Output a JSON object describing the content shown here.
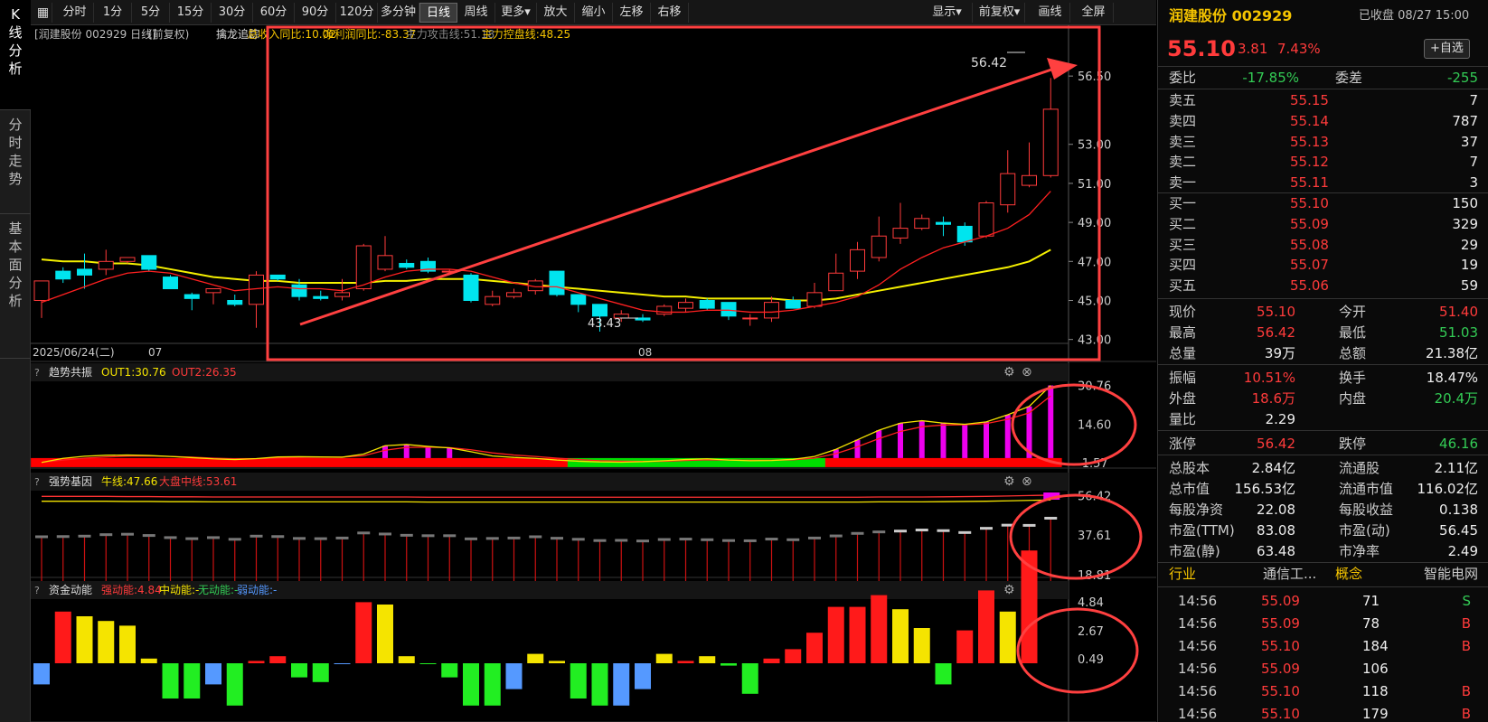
{
  "side_tabs": [
    "K线分析",
    "分时走势",
    "基本面分析"
  ],
  "toolbar": {
    "items": [
      "分时",
      "1分",
      "5分",
      "15分",
      "30分",
      "60分",
      "90分",
      "120分",
      "多分钟",
      "日线",
      "周线",
      "更多▾",
      "放大",
      "缩小",
      "左移",
      "右移"
    ],
    "active": "日线",
    "right": [
      "显示▾",
      "前复权▾",
      "画线",
      "全屏"
    ]
  },
  "chart": {
    "title": "[润建股份 002929 日线]",
    "fq": "(前复权)",
    "ind": [
      {
        "t": "擒龙追踪",
        "c": "#ddd"
      },
      {
        "t": "总收入同比:10.02",
        "c": "#f5c400"
      },
      {
        "t": "净利润同比:-83.37",
        "c": "#f5c400"
      },
      {
        "t": "主力攻击线:51.18",
        "c": "#888"
      },
      {
        "t": "主力控盘线:48.25",
        "c": "#f5c400"
      }
    ],
    "yticks": [
      "56.50",
      "53.00",
      "51.00",
      "49.00",
      "47.00",
      "45.00",
      "43.00"
    ],
    "xlabels": [
      "2025/06/24(二)",
      "07",
      "08"
    ],
    "high_label": "56.42",
    "low_label": "43.43"
  },
  "panels": [
    {
      "name": "趋势共振",
      "legend": [
        {
          "t": "OUT1:30.76",
          "c": "#f5e400"
        },
        {
          "t": "OUT2:26.35",
          "c": "#ff3b3b"
        }
      ],
      "ticks": [
        "30.76",
        "14.60",
        "-1.57"
      ]
    },
    {
      "name": "强势基因",
      "legend": [
        {
          "t": "牛线:47.66",
          "c": "#f5e400"
        },
        {
          "t": "大盘中线:53.61",
          "c": "#ff3b3b"
        }
      ],
      "ticks": [
        "56.42",
        "37.61",
        "18.81"
      ]
    },
    {
      "name": "资金动能",
      "legend": [
        {
          "t": "强动能:4.84",
          "c": "#ff3b3b"
        },
        {
          "t": "中动能:-",
          "c": "#f5e400"
        },
        {
          "t": "无动能:-",
          "c": "#33cc55"
        },
        {
          "t": "弱动能:-",
          "c": "#5599ff"
        }
      ],
      "ticks": [
        "4.84",
        "2.67",
        "0.49"
      ]
    }
  ],
  "candles": [
    [
      45.0,
      46.0,
      44.1,
      46.0
    ],
    [
      46.5,
      46.1,
      45.9,
      46.7
    ],
    [
      46.6,
      46.3,
      45.6,
      47.4
    ],
    [
      46.6,
      47.0,
      46.3,
      47.6
    ],
    [
      47.0,
      47.2,
      46.9,
      47.2
    ],
    [
      47.3,
      46.6,
      46.5,
      47.3
    ],
    [
      46.2,
      45.6,
      45.6,
      46.3
    ],
    [
      45.3,
      45.1,
      44.5,
      45.4
    ],
    [
      45.4,
      45.6,
      44.8,
      45.6
    ],
    [
      45.0,
      44.8,
      44.7,
      45.3
    ],
    [
      44.8,
      46.3,
      43.6,
      46.5
    ],
    [
      46.3,
      46.1,
      46.0,
      46.3
    ],
    [
      45.8,
      45.2,
      45.0,
      46.1
    ],
    [
      45.2,
      45.1,
      45.0,
      45.5
    ],
    [
      45.2,
      45.4,
      45.0,
      46.1
    ],
    [
      45.6,
      47.8,
      45.5,
      47.9
    ],
    [
      46.6,
      47.3,
      46.5,
      48.3
    ],
    [
      46.9,
      46.7,
      46.6,
      47.1
    ],
    [
      47.0,
      46.5,
      46.4,
      47.2
    ],
    [
      46.5,
      46.5,
      46.3,
      46.6
    ],
    [
      46.3,
      45.0,
      44.9,
      46.4
    ],
    [
      44.8,
      45.2,
      44.7,
      45.5
    ],
    [
      45.2,
      45.4,
      45.1,
      45.6
    ],
    [
      45.5,
      46.0,
      45.3,
      46.1
    ],
    [
      46.5,
      45.3,
      45.2,
      46.5
    ],
    [
      45.3,
      44.8,
      44.4,
      45.3
    ],
    [
      44.8,
      44.2,
      43.4,
      44.8
    ],
    [
      44.1,
      44.3,
      43.9,
      44.5
    ],
    [
      44.1,
      44.0,
      43.9,
      44.3
    ],
    [
      44.3,
      44.7,
      44.2,
      44.8
    ],
    [
      44.6,
      44.9,
      44.4,
      45.1
    ],
    [
      45.0,
      44.6,
      44.5,
      45.1
    ],
    [
      44.9,
      44.2,
      44.0,
      44.9
    ],
    [
      44.1,
      44.1,
      43.7,
      44.3
    ],
    [
      44.1,
      44.9,
      43.9,
      45.2
    ],
    [
      45.0,
      44.6,
      44.6,
      45.2
    ],
    [
      44.7,
      45.4,
      44.6,
      45.9
    ],
    [
      45.5,
      46.4,
      45.5,
      47.4
    ],
    [
      46.5,
      47.6,
      46.1,
      48.0
    ],
    [
      47.2,
      48.3,
      47.0,
      49.3
    ],
    [
      48.2,
      48.7,
      47.9,
      50.0
    ],
    [
      48.7,
      49.2,
      48.6,
      49.4
    ],
    [
      49.0,
      48.9,
      48.3,
      49.3
    ],
    [
      48.8,
      48.0,
      47.8,
      49.0
    ],
    [
      48.3,
      50.0,
      48.2,
      50.1
    ],
    [
      49.9,
      51.5,
      49.5,
      52.7
    ],
    [
      50.9,
      51.4,
      50.8,
      53.1
    ],
    [
      51.4,
      54.8,
      51.3,
      56.4
    ]
  ],
  "ma_fast": [
    44.9,
    45.3,
    45.7,
    46.1,
    46.4,
    46.5,
    46.4,
    46.1,
    45.8,
    45.5,
    45.6,
    45.7,
    45.6,
    45.6,
    45.5,
    45.8,
    46.2,
    46.5,
    46.6,
    46.6,
    46.5,
    46.2,
    45.9,
    45.7,
    45.7,
    45.4,
    45.1,
    44.8,
    44.5,
    44.4,
    44.4,
    44.5,
    44.5,
    44.4,
    44.4,
    44.5,
    44.7,
    44.9,
    45.2,
    45.8,
    46.6,
    47.2,
    47.7,
    48.0,
    48.3,
    48.7,
    49.4,
    50.6
  ],
  "ma_slow": [
    47.1,
    47.0,
    47.0,
    46.9,
    46.9,
    46.8,
    46.6,
    46.4,
    46.2,
    46.1,
    46.0,
    46.0,
    45.9,
    45.9,
    45.9,
    45.9,
    46.0,
    46.0,
    46.1,
    46.1,
    46.1,
    46.0,
    45.9,
    45.8,
    45.7,
    45.6,
    45.5,
    45.4,
    45.3,
    45.2,
    45.2,
    45.1,
    45.1,
    45.1,
    45.1,
    45.0,
    45.0,
    45.1,
    45.3,
    45.5,
    45.7,
    45.9,
    46.1,
    46.3,
    46.5,
    46.7,
    47.0,
    47.6
  ],
  "trend_out1": [
    -1.5,
    0.2,
    1.1,
    1.5,
    1.6,
    1.4,
    1.0,
    0.5,
    0.0,
    -0.3,
    0.1,
    0.8,
    0.9,
    0.8,
    0.7,
    2.0,
    5.5,
    6.0,
    5.2,
    4.6,
    3.0,
    1.2,
    0.6,
    0.2,
    -0.5,
    -1.0,
    -1.3,
    -1.4,
    -1.2,
    -0.8,
    -0.3,
    0.0,
    -0.5,
    -0.8,
    -0.7,
    -0.2,
    1.0,
    4.0,
    8.0,
    12.0,
    15.0,
    16.0,
    15.0,
    14.5,
    15.5,
    18.5,
    22.0,
    30.8
  ],
  "trend_out2": [
    -1.5,
    -0.5,
    0.3,
    0.8,
    1.1,
    1.2,
    1.0,
    0.7,
    0.3,
    0.0,
    0.0,
    0.4,
    0.6,
    0.7,
    0.7,
    1.3,
    3.6,
    4.8,
    4.9,
    4.7,
    3.8,
    2.5,
    1.6,
    1.0,
    0.3,
    -0.3,
    -0.8,
    -1.0,
    -1.1,
    -1.0,
    -0.7,
    -0.4,
    -0.5,
    -0.6,
    -0.6,
    -0.4,
    0.3,
    2.2,
    5.1,
    8.5,
    11.5,
    13.5,
    14.2,
    14.3,
    14.8,
    16.6,
    19.3,
    26.4
  ],
  "trend_bars": [
    0,
    0,
    0,
    0,
    0,
    0,
    0,
    0,
    0,
    0,
    0,
    0,
    0,
    0,
    0,
    0,
    5.5,
    6.0,
    5.2,
    4.6,
    0,
    0,
    0,
    0,
    0,
    0,
    0,
    0,
    0,
    0,
    0,
    0,
    0,
    0,
    0,
    0,
    0,
    4.0,
    8.0,
    12.0,
    15.0,
    16.0,
    15.0,
    14.5,
    15.5,
    18.5,
    22.0,
    30.8
  ],
  "trend_band": [
    1,
    1,
    1,
    1,
    1,
    1,
    1,
    1,
    1,
    1,
    1,
    1,
    1,
    1,
    1,
    1,
    1,
    1,
    1,
    1,
    1,
    1,
    1,
    1,
    1,
    0,
    0,
    0,
    0,
    0,
    0,
    0,
    0,
    0,
    0,
    0,
    0,
    1,
    1,
    1,
    1,
    1,
    1,
    1,
    1,
    1,
    1,
    1
  ],
  "gene_line": [
    56.0,
    56.0,
    56.0,
    56.0,
    55.9,
    55.9,
    55.8,
    55.8,
    55.7,
    55.7,
    55.7,
    55.7,
    55.7,
    55.7,
    55.7,
    55.7,
    55.7,
    55.7,
    55.6,
    55.6,
    55.6,
    55.6,
    55.6,
    55.6,
    55.6,
    55.6,
    55.6,
    55.6,
    55.6,
    55.6,
    55.6,
    55.6,
    55.6,
    55.6,
    55.6,
    55.6,
    55.6,
    55.6,
    55.6,
    55.7,
    55.7,
    55.7,
    55.8,
    55.9,
    56.0,
    56.2,
    56.4,
    56.6
  ],
  "money": [
    {
      "v": 0.9,
      "c": "#5599ff"
    },
    {
      "v": 2.2,
      "c": "#ff1a1a"
    },
    {
      "v": 2.0,
      "c": "#f5e400"
    },
    {
      "v": 1.8,
      "c": "#f5e400"
    },
    {
      "v": 1.6,
      "c": "#f5e400"
    },
    {
      "v": 0.2,
      "c": "#f5e400"
    },
    {
      "v": 1.5,
      "c": "#22ee22"
    },
    {
      "v": 1.5,
      "c": "#22ee22"
    },
    {
      "v": 0.9,
      "c": "#5599ff"
    },
    {
      "v": 1.8,
      "c": "#22ee22"
    },
    {
      "v": 0.1,
      "c": "#ff1a1a"
    },
    {
      "v": 0.3,
      "c": "#ff1a1a"
    },
    {
      "v": 0.6,
      "c": "#22ee22"
    },
    {
      "v": 0.8,
      "c": "#22ee22"
    },
    {
      "v": 0.0,
      "c": "#5599ff"
    },
    {
      "v": 2.6,
      "c": "#ff1a1a"
    },
    {
      "v": 2.5,
      "c": "#f5e400"
    },
    {
      "v": 0.3,
      "c": "#f5e400"
    },
    {
      "v": 0.0,
      "c": "#22ee22"
    },
    {
      "v": 0.6,
      "c": "#22ee22"
    },
    {
      "v": 1.8,
      "c": "#22ee22"
    },
    {
      "v": 1.8,
      "c": "#22ee22"
    },
    {
      "v": 1.1,
      "c": "#5599ff"
    },
    {
      "v": 0.4,
      "c": "#f5e400"
    },
    {
      "v": 0.1,
      "c": "#f5e400"
    },
    {
      "v": 1.5,
      "c": "#22ee22"
    },
    {
      "v": 1.8,
      "c": "#22ee22"
    },
    {
      "v": 1.8,
      "c": "#5599ff"
    },
    {
      "v": 1.1,
      "c": "#5599ff"
    },
    {
      "v": 0.4,
      "c": "#f5e400"
    },
    {
      "v": 0.1,
      "c": "#ff1a1a"
    },
    {
      "v": 0.3,
      "c": "#f5e400"
    },
    {
      "v": 0.1,
      "c": "#22ee22"
    },
    {
      "v": 1.3,
      "c": "#22ee22"
    },
    {
      "v": 0.2,
      "c": "#ff1a1a"
    },
    {
      "v": 0.6,
      "c": "#ff1a1a"
    },
    {
      "v": 1.3,
      "c": "#ff1a1a"
    },
    {
      "v": 2.4,
      "c": "#ff1a1a"
    },
    {
      "v": 2.4,
      "c": "#ff1a1a"
    },
    {
      "v": 2.9,
      "c": "#ff1a1a"
    },
    {
      "v": 2.3,
      "c": "#f5e400"
    },
    {
      "v": 1.5,
      "c": "#f5e400"
    },
    {
      "v": 0.9,
      "c": "#22ee22"
    },
    {
      "v": 1.4,
      "c": "#ff1a1a"
    },
    {
      "v": 3.1,
      "c": "#ff1a1a"
    },
    {
      "v": 2.2,
      "c": "#f5e400"
    },
    {
      "v": 4.8,
      "c": "#ff1a1a"
    }
  ],
  "quote": {
    "name": "润建股份 002929",
    "status": "已收盘 08/27 15:00",
    "price": "55.10",
    "chg": "3.81",
    "pct": "7.43%",
    "fav": "+自选",
    "wb_label": "委比",
    "wb": "-17.85%",
    "wc_label": "委差",
    "wc": "-255",
    "asks": [
      [
        "卖五",
        "55.15",
        "7"
      ],
      [
        "卖四",
        "55.14",
        "787"
      ],
      [
        "卖三",
        "55.13",
        "37"
      ],
      [
        "卖二",
        "55.12",
        "7"
      ],
      [
        "卖一",
        "55.11",
        "3"
      ]
    ],
    "bids": [
      [
        "买一",
        "55.10",
        "150"
      ],
      [
        "买二",
        "55.09",
        "329"
      ],
      [
        "买三",
        "55.08",
        "29"
      ],
      [
        "买四",
        "55.07",
        "19"
      ],
      [
        "买五",
        "55.06",
        "59"
      ]
    ],
    "stats": [
      [
        [
          "现价",
          "55.10",
          "red"
        ],
        [
          "今开",
          "51.40",
          "red"
        ]
      ],
      [
        [
          "最高",
          "56.42",
          "red"
        ],
        [
          "最低",
          "51.03",
          "grn"
        ]
      ],
      [
        [
          "总量",
          "39万",
          "wht"
        ],
        [
          "总额",
          "21.38亿",
          "wht"
        ]
      ],
      [
        [
          "振幅",
          "10.51%",
          "red"
        ],
        [
          "换手",
          "18.47%",
          "wht"
        ]
      ],
      [
        [
          "外盘",
          "18.6万",
          "red"
        ],
        [
          "内盘",
          "20.4万",
          "grn"
        ]
      ],
      [
        [
          "量比",
          "2.29",
          "wht"
        ]
      ],
      [
        [
          "涨停",
          "56.42",
          "red"
        ],
        [
          "跌停",
          "46.16",
          "grn"
        ]
      ],
      [
        [
          "总股本",
          "2.84亿",
          "wht"
        ],
        [
          "流通股",
          "2.11亿",
          "wht"
        ]
      ],
      [
        [
          "总市值",
          "156.53亿",
          "wht"
        ],
        [
          "流通市值",
          "116.02亿",
          "wht"
        ]
      ],
      [
        [
          "每股净资",
          "22.08",
          "wht"
        ],
        [
          "每股收益",
          "0.138",
          "wht"
        ]
      ],
      [
        [
          "市盈(TTM)",
          "83.08",
          "wht"
        ],
        [
          "市盈(动)",
          "56.45",
          "wht"
        ]
      ],
      [
        [
          "市盈(静)",
          "63.48",
          "wht"
        ],
        [
          "市净率",
          "2.49",
          "wht"
        ]
      ]
    ],
    "industry": [
      "行业",
      "通信工...",
      "概念",
      "智能电网"
    ],
    "ticks": [
      [
        "14:56",
        "55.09",
        "71",
        "S"
      ],
      [
        "14:56",
        "55.09",
        "78",
        "B"
      ],
      [
        "14:56",
        "55.10",
        "184",
        "B"
      ],
      [
        "14:56",
        "55.09",
        "106",
        ""
      ],
      [
        "14:56",
        "55.10",
        "118",
        "B"
      ],
      [
        "14:56",
        "55.10",
        "179",
        "B"
      ]
    ]
  },
  "colors": {
    "up": "#ff3b3b",
    "down": "#00e5ee",
    "ma_fast": "#ff2020",
    "ma_slow": "#f5f000",
    "annot": "#ff4040"
  }
}
